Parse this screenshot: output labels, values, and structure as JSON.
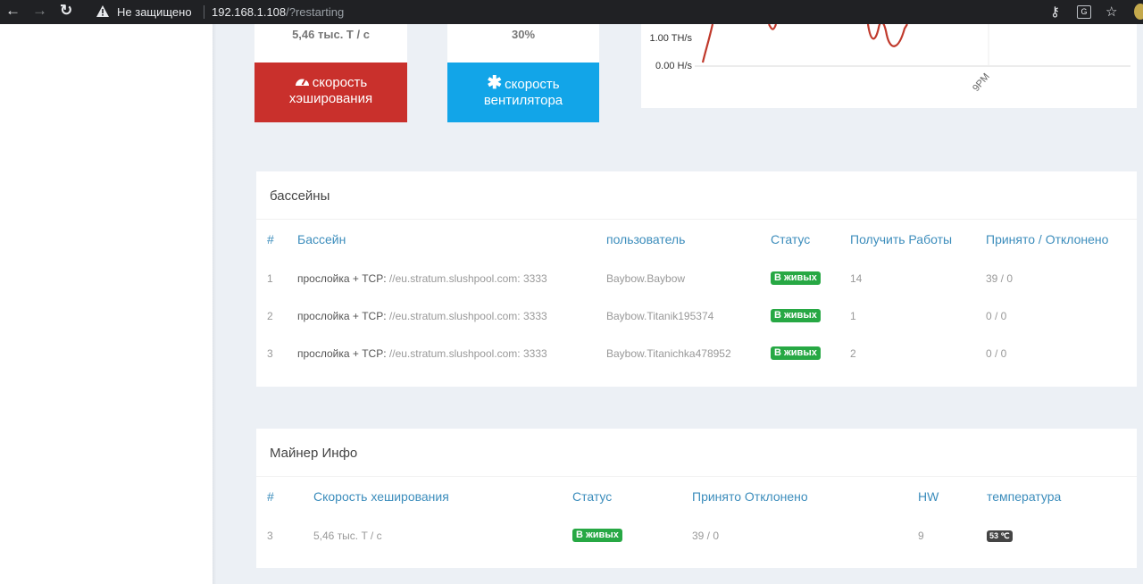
{
  "browser": {
    "security_text": "Не защищено",
    "url_host": "192.168.1.108",
    "url_path": "/?restarting"
  },
  "stats": {
    "hashrate_value": "5,46 тыс. T / с",
    "hashrate_label_1": "скорость",
    "hashrate_label_2": "хэширования",
    "fan_value": "30%",
    "fan_label_1": "скорость",
    "fan_label_2": "вентилятора"
  },
  "chart_data": {
    "type": "line",
    "y_tick_labels": [
      "0.00 H/s",
      "1.00 TH/s"
    ],
    "x_tick_labels": [
      "9PM"
    ],
    "series_color": "#c0392b"
  },
  "pools": {
    "title": "бассейны",
    "columns": [
      "#",
      "Бассейн",
      "пользователь",
      "Статус",
      "Получить Работы",
      "Принято / Отклонено"
    ],
    "rows": [
      {
        "num": "1",
        "proto": "прослойка + TCP:",
        "addr": "//eu.stratum.slushpool.com: 3333",
        "user": "Baybow.Baybow",
        "status": "В живых",
        "works": "14",
        "acc": "39 / 0"
      },
      {
        "num": "2",
        "proto": "прослойка + TCP:",
        "addr": "//eu.stratum.slushpool.com: 3333",
        "user": "Baybow.Titanik195374",
        "status": "В живых",
        "works": "1",
        "acc": "0 / 0"
      },
      {
        "num": "3",
        "proto": "прослойка + TCP:",
        "addr": "//eu.stratum.slushpool.com: 3333",
        "user": "Baybow.Titanichka478952",
        "status": "В живых",
        "works": "2",
        "acc": "0 / 0"
      }
    ]
  },
  "miner": {
    "title": "Майнер Инфо",
    "columns": [
      "#",
      "Скорость хеширования",
      "Статус",
      "Принято Отклонено",
      "HW",
      "температура"
    ],
    "row": {
      "num": "3",
      "hashrate": "5,46 тыс. T / с",
      "status": "В живых",
      "acc": "39 / 0",
      "hw": "9",
      "temp": "53 ℃"
    }
  }
}
